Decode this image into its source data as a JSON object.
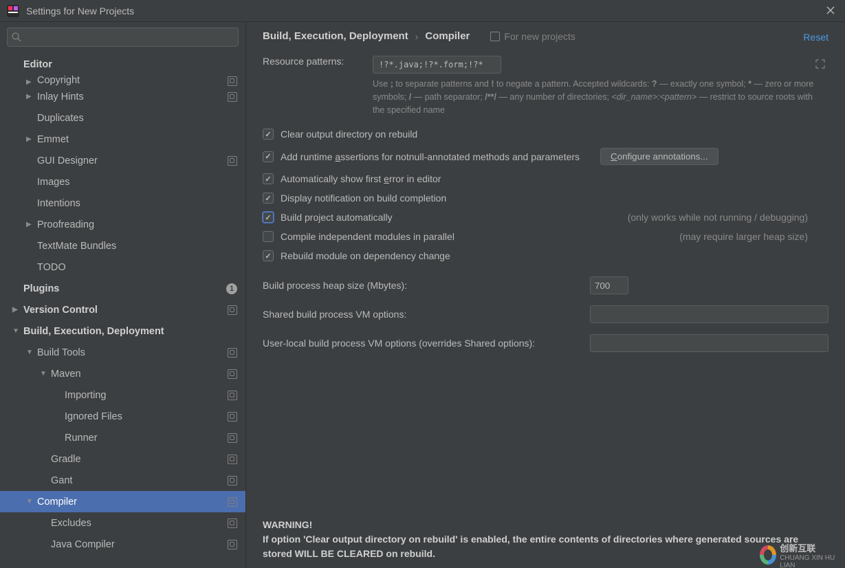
{
  "window": {
    "title": "Settings for New Projects"
  },
  "search": {
    "placeholder": ""
  },
  "tree": {
    "items": [
      {
        "label": "Editor",
        "depth": 1,
        "arrow": "",
        "bold": true,
        "scope": false
      },
      {
        "label": "Copyright",
        "depth": 2,
        "arrow": "▶",
        "bold": false,
        "scope": true
      },
      {
        "label": "Inlay Hints",
        "depth": 2,
        "arrow": "▶",
        "bold": false,
        "scope": true
      },
      {
        "label": "Duplicates",
        "depth": 2,
        "arrow": "",
        "bold": false,
        "scope": false
      },
      {
        "label": "Emmet",
        "depth": 2,
        "arrow": "▶",
        "bold": false,
        "scope": false
      },
      {
        "label": "GUI Designer",
        "depth": 2,
        "arrow": "",
        "bold": false,
        "scope": true
      },
      {
        "label": "Images",
        "depth": 2,
        "arrow": "",
        "bold": false,
        "scope": false
      },
      {
        "label": "Intentions",
        "depth": 2,
        "arrow": "",
        "bold": false,
        "scope": false
      },
      {
        "label": "Proofreading",
        "depth": 2,
        "arrow": "▶",
        "bold": false,
        "scope": false
      },
      {
        "label": "TextMate Bundles",
        "depth": 2,
        "arrow": "",
        "bold": false,
        "scope": false
      },
      {
        "label": "TODO",
        "depth": 2,
        "arrow": "",
        "bold": false,
        "scope": false
      },
      {
        "label": "Plugins",
        "depth": 1,
        "arrow": "",
        "bold": true,
        "scope": false,
        "badge": "1"
      },
      {
        "label": "Version Control",
        "depth": 1,
        "arrow": "▶",
        "bold": true,
        "scope": true
      },
      {
        "label": "Build, Execution, Deployment",
        "depth": 1,
        "arrow": "▼",
        "bold": true,
        "scope": false
      },
      {
        "label": "Build Tools",
        "depth": 2,
        "arrow": "▼",
        "bold": false,
        "scope": true
      },
      {
        "label": "Maven",
        "depth": 3,
        "arrow": "▼",
        "bold": false,
        "scope": true
      },
      {
        "label": "Importing",
        "depth": 4,
        "arrow": "",
        "bold": false,
        "scope": true
      },
      {
        "label": "Ignored Files",
        "depth": 4,
        "arrow": "",
        "bold": false,
        "scope": true
      },
      {
        "label": "Runner",
        "depth": 4,
        "arrow": "",
        "bold": false,
        "scope": true
      },
      {
        "label": "Gradle",
        "depth": 3,
        "arrow": "",
        "bold": false,
        "scope": true
      },
      {
        "label": "Gant",
        "depth": 3,
        "arrow": "",
        "bold": false,
        "scope": true
      },
      {
        "label": "Compiler",
        "depth": 2,
        "arrow": "▼",
        "bold": false,
        "scope": true,
        "selected": true
      },
      {
        "label": "Excludes",
        "depth": 3,
        "arrow": "",
        "bold": false,
        "scope": true
      },
      {
        "label": "Java Compiler",
        "depth": 3,
        "arrow": "",
        "bold": false,
        "scope": true
      }
    ]
  },
  "breadcrumb": {
    "a": "Build, Execution, Deployment",
    "b": "Compiler",
    "note": "For new projects"
  },
  "reset": "Reset",
  "resource": {
    "label": "Resource patterns:",
    "value": "!?*.java;!?*.form;!?*.class;!?*.groovy;!?*.scala;!?*.flex;!?*.kt;!?*.clj;!?*.aj",
    "hint_a": "Use ",
    "hint_b": " to separate patterns and ",
    "hint_c": " to negate a pattern. Accepted wildcards: ",
    "hint_d": " — exactly one symbol; ",
    "hint_e": " — zero or more symbols; ",
    "hint_f": " — path separator; ",
    "hint_g": " — any number of directories; ",
    "hint_h": " — restrict to source roots with the specified name",
    "s_semi": ";",
    "s_bang": "!",
    "s_q": "?",
    "s_star": "*",
    "s_slash": "/",
    "s_dstar": "/**/",
    "s_dirpat": "<dir_name>:<pattern>"
  },
  "checks": {
    "c0": {
      "label": "Clear output directory on rebuild",
      "checked": true
    },
    "c1": {
      "label": "Add runtime assertions for notnull-annotated methods and parameters",
      "checked": true,
      "btn": "Configure annotations...",
      "underline_char": "a",
      "prefix": "Add runtime ",
      "suffix": "ssertions for notnull-annotated methods and parameters"
    },
    "c2": {
      "prefix": "Automatically show first ",
      "under": "e",
      "suffix": "rror in editor",
      "checked": true
    },
    "c3": {
      "label": "Display notification on build completion",
      "checked": true
    },
    "c4": {
      "label": "Build project automatically",
      "checked": true,
      "note": "(only works while not running / debugging)",
      "hl": true
    },
    "c5": {
      "label": "Compile independent modules in parallel",
      "checked": false,
      "note": "(may require larger heap size)"
    },
    "c6": {
      "label": "Rebuild module on dependency change",
      "checked": true
    }
  },
  "fields": {
    "heap": {
      "label": "Build process heap size (Mbytes):",
      "value": "700"
    },
    "shared": {
      "label": "Shared build process VM options:",
      "value": ""
    },
    "local": {
      "label": "User-local build process VM options (overrides Shared options):",
      "value": ""
    }
  },
  "warning": {
    "title": "WARNING!",
    "body": "If option 'Clear output directory on rebuild' is enabled, the entire contents of directories where generated sources are stored WILL BE CLEARED on rebuild."
  },
  "watermark": {
    "a": "创新互联",
    "b": "CHUANG XIN HU LIAN"
  }
}
